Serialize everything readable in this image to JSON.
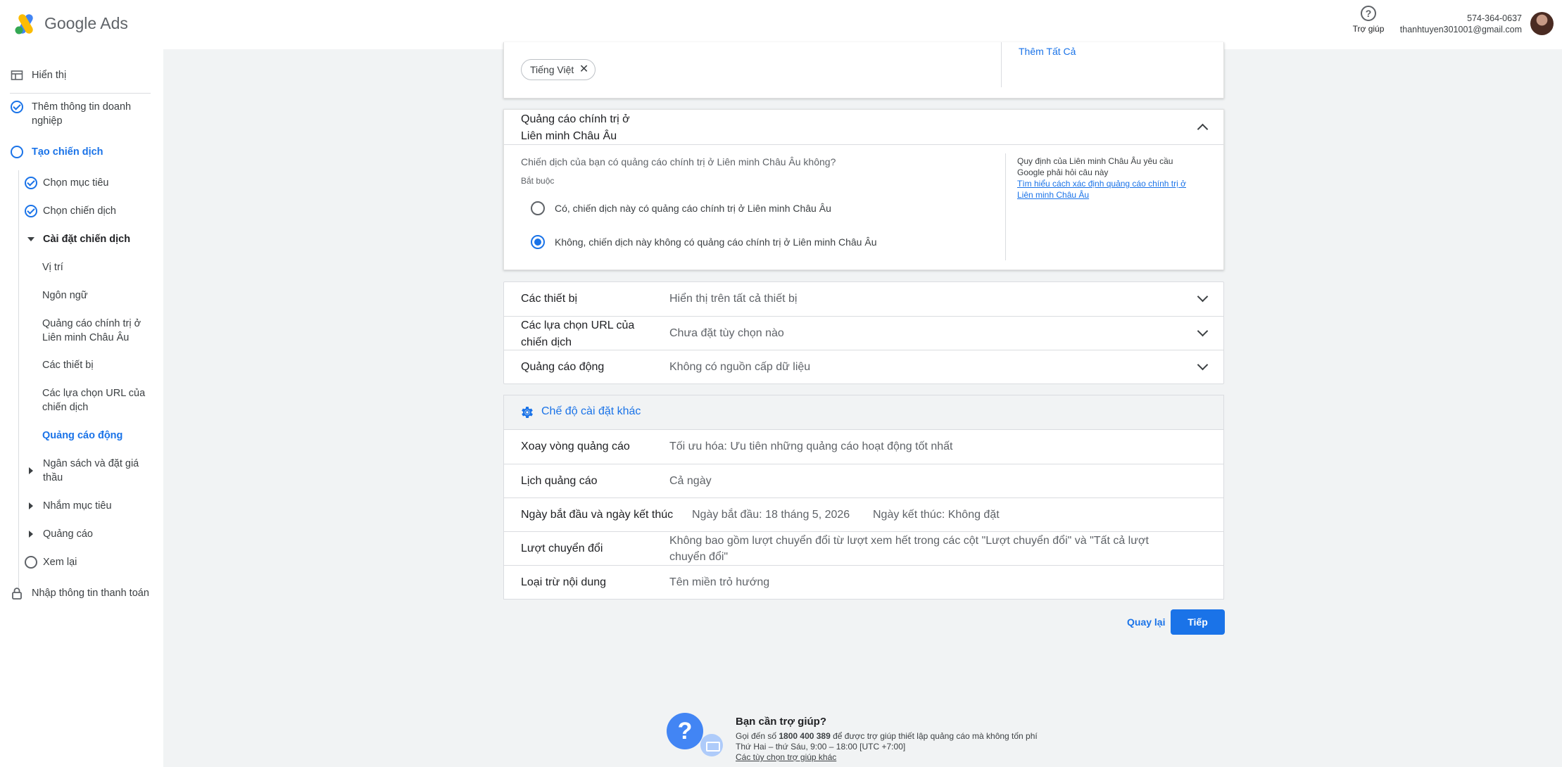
{
  "header": {
    "brand": "Google Ads",
    "help_label": "Trợ giúp",
    "account_id": "574-364-0637",
    "email": "thanhtuyen301001@gmail.com"
  },
  "sidebar": {
    "items": [
      {
        "label": "Hiển thị"
      },
      {
        "label": "Thêm thông tin doanh nghiệp"
      },
      {
        "label": "Tạo chiến dịch"
      },
      {
        "label": "Chọn mục tiêu"
      },
      {
        "label": "Chọn chiến dịch"
      },
      {
        "label": "Cài đặt chiến dịch"
      },
      {
        "label": "Vị trí"
      },
      {
        "label": "Ngôn ngữ"
      },
      {
        "label": "Quảng cáo chính trị ở Liên minh Châu Âu"
      },
      {
        "label": "Các thiết bị"
      },
      {
        "label": "Các lựa chọn URL của chiến dịch"
      },
      {
        "label": "Quảng cáo động"
      },
      {
        "label": "Ngân sách và đặt giá thầu"
      },
      {
        "label": "Nhắm mục tiêu"
      },
      {
        "label": "Quảng cáo"
      },
      {
        "label": "Xem lại"
      },
      {
        "label": "Nhập thông tin thanh toán"
      }
    ]
  },
  "language_card": {
    "chip_label": "Tiếng Việt",
    "chip_close": "✕",
    "add_all": "Thêm Tất Cả"
  },
  "eu_card": {
    "title_line1": "Quảng cáo chính trị ở",
    "title_line2": "Liên minh Châu Âu",
    "question": "Chiến dịch của bạn có quảng cáo chính trị ở Liên minh Châu Âu không?",
    "required": "Bắt buộc",
    "option_yes": "Có, chiến dịch này có quảng cáo chính trị ở Liên minh Châu Âu",
    "option_no": "Không, chiến dịch này không có quảng cáo chính trị ở Liên minh Châu Âu",
    "selected": "no",
    "side_note": "Quy định của Liên minh Châu Âu yêu cầu Google phải hỏi câu này",
    "side_link": "Tìm hiểu cách xác định quảng cáo chính trị ở Liên minh Châu Âu"
  },
  "settings": {
    "devices": {
      "label": "Các thiết bị",
      "value": "Hiển thị trên tất cả thiết bị"
    },
    "url_options": {
      "label_line1": "Các lựa chọn URL của",
      "label_line2": "chiến dịch",
      "value": "Chưa đặt tùy chọn nào"
    },
    "dynamic_ads": {
      "label": "Quảng cáo động",
      "value": "Không có nguồn cấp dữ liệu"
    }
  },
  "more_settings": {
    "title": "Chế độ cài đặt khác",
    "ad_rotation": {
      "label": "Xoay vòng quảng cáo",
      "value": "Tối ưu hóa: Ưu tiên những quảng cáo hoạt động tốt nhất"
    },
    "ad_schedule": {
      "label": "Lịch quảng cáo",
      "value": "Cả ngày"
    },
    "dates": {
      "label": "Ngày bắt đầu và ngày kết thúc",
      "start": "Ngày bắt đầu: 18 tháng 5, 2026",
      "end": "Ngày kết thúc: Không đặt"
    },
    "conversions": {
      "label": "Lượt chuyển đổi",
      "value_line1": "Không bao gồm lượt chuyển đổi từ lượt xem hết trong các cột \"Lượt chuyển đổi\" và \"Tất cả lượt",
      "value_line2": "chuyển đổi\""
    },
    "content_exclusion": {
      "label": "Loại trừ nội dung",
      "value": "Tên miền trỏ hướng"
    }
  },
  "actions": {
    "back": "Quay lại",
    "next": "Tiếp"
  },
  "help_footer": {
    "title": "Bạn cần trợ giúp?",
    "call_prefix": "Gọi đến số ",
    "phone": "1800 400 389",
    "call_suffix": " để được trợ giúp thiết lập quảng cáo mà không tốn phí",
    "hours": "Thứ Hai – thứ Sáu, 9:00 – 18:00 [UTC +7:00]",
    "other_options": "Các tùy chọn trợ giúp khác"
  }
}
